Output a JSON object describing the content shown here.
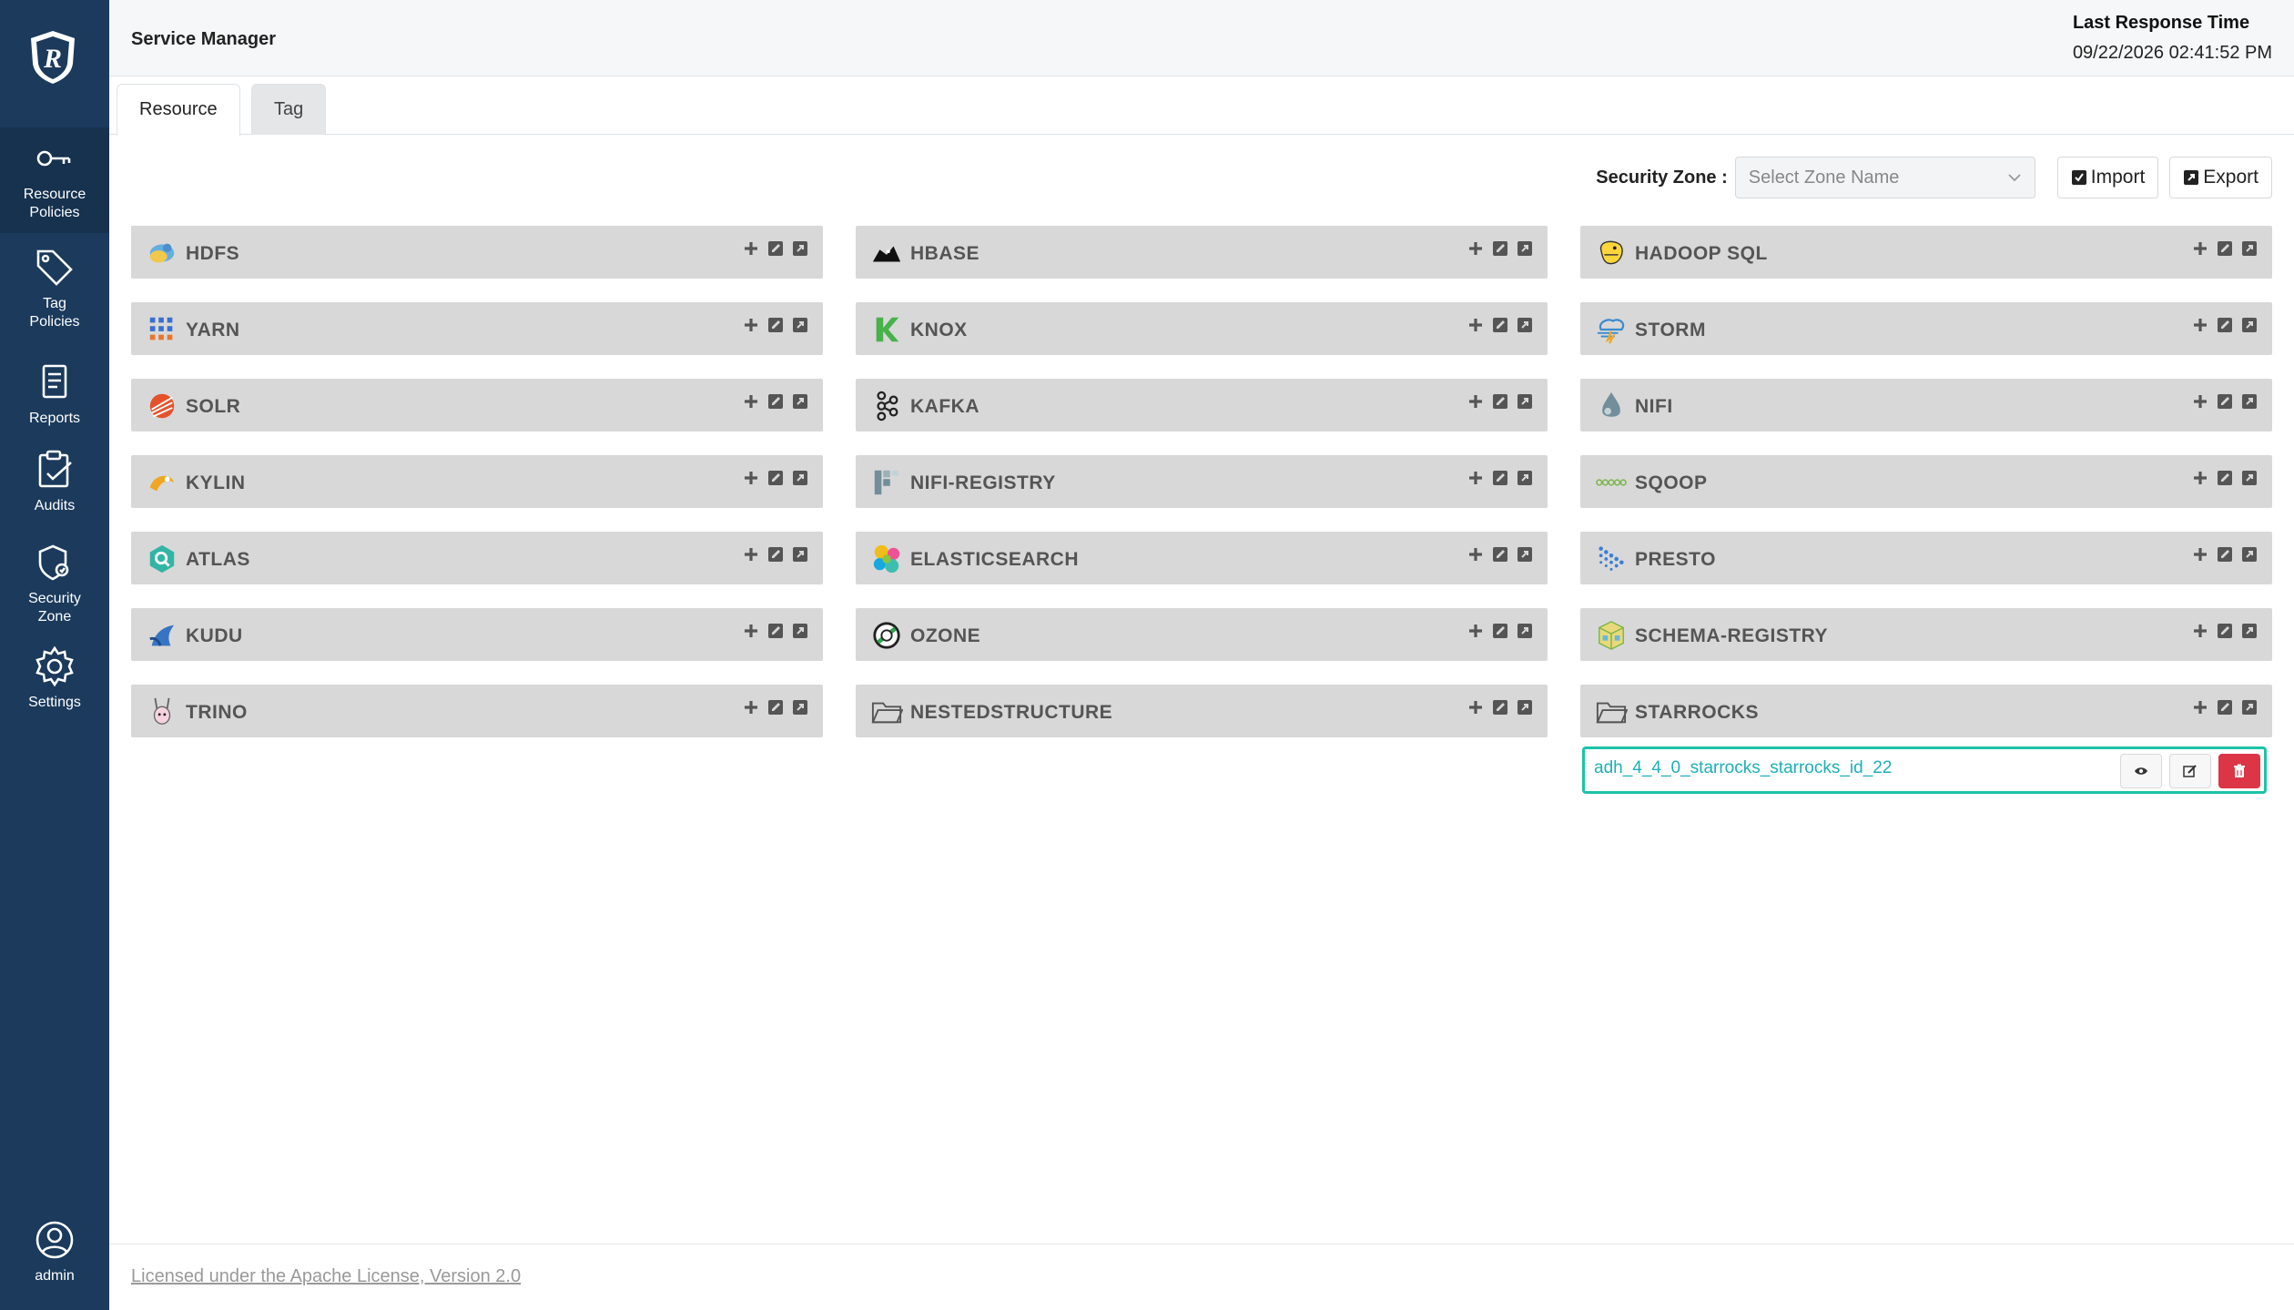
{
  "sidebar": {
    "items": [
      {
        "label": "Resource\nPolicies",
        "icon": "key-icon"
      },
      {
        "label": "Tag\nPolicies",
        "icon": "tag-icon"
      },
      {
        "label": "Reports",
        "icon": "report-icon"
      },
      {
        "label": "Audits",
        "icon": "clipboard-check-icon"
      },
      {
        "label": "Security\nZone",
        "icon": "shield-icon"
      },
      {
        "label": "Settings",
        "icon": "gear-icon"
      }
    ],
    "user_label": "admin"
  },
  "header": {
    "title": "Service Manager",
    "response_label": "Last Response Time",
    "response_value": "09/22/2026 02:41:52 PM"
  },
  "tabs": [
    {
      "label": "Resource",
      "active": true
    },
    {
      "label": "Tag",
      "active": false
    }
  ],
  "toolbar": {
    "zone_label": "Security Zone :",
    "zone_placeholder": "Select Zone Name",
    "import_label": "Import",
    "export_label": "Export"
  },
  "columns": [
    [
      {
        "name": "HDFS",
        "icon": "hdfs-icon"
      },
      {
        "name": "YARN",
        "icon": "yarn-icon"
      },
      {
        "name": "SOLR",
        "icon": "solr-icon"
      },
      {
        "name": "KYLIN",
        "icon": "kylin-icon"
      },
      {
        "name": "ATLAS",
        "icon": "atlas-icon"
      },
      {
        "name": "KUDU",
        "icon": "kudu-icon"
      },
      {
        "name": "TRINO",
        "icon": "trino-icon"
      }
    ],
    [
      {
        "name": "HBASE",
        "icon": "hbase-icon"
      },
      {
        "name": "KNOX",
        "icon": "knox-icon"
      },
      {
        "name": "KAFKA",
        "icon": "kafka-icon"
      },
      {
        "name": "NIFI-REGISTRY",
        "icon": "nifi-registry-icon"
      },
      {
        "name": "ELASTICSEARCH",
        "icon": "elasticsearch-icon"
      },
      {
        "name": "OZONE",
        "icon": "ozone-icon"
      },
      {
        "name": "NESTEDSTRUCTURE",
        "icon": "folder-icon"
      }
    ],
    [
      {
        "name": "HADOOP SQL",
        "icon": "hadoop-sql-icon"
      },
      {
        "name": "STORM",
        "icon": "storm-icon"
      },
      {
        "name": "NIFI",
        "icon": "nifi-icon"
      },
      {
        "name": "SQOOP",
        "icon": "sqoop-icon"
      },
      {
        "name": "PRESTO",
        "icon": "presto-icon"
      },
      {
        "name": "SCHEMA-REGISTRY",
        "icon": "schema-registry-icon"
      },
      {
        "name": "STARROCKS",
        "icon": "folder-icon"
      }
    ]
  ],
  "starrocks_service": "adh_4_4_0_starrocks_starrocks_id_22",
  "footer": {
    "license": "Licensed under the Apache License, Version 2.0"
  },
  "colors": {
    "sidebar": "#1b3a5c",
    "accent": "#1cc3a8",
    "link": "#1cb0b8",
    "danger": "#dc3545",
    "card": "#d8d8d8"
  }
}
